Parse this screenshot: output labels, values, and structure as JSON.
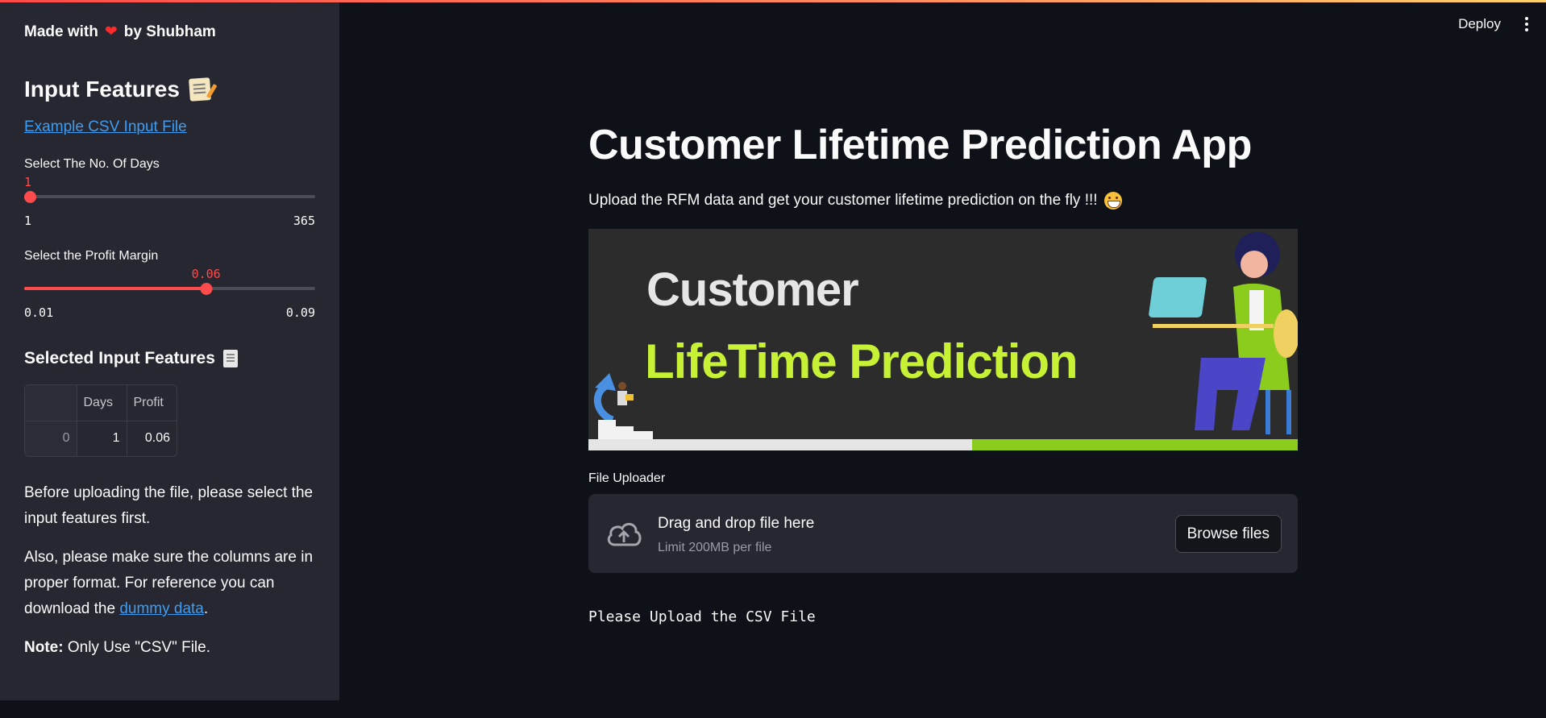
{
  "sidebar": {
    "made_with_prefix": "Made with",
    "made_with_suffix": "by Shubham",
    "heart_icon": "heart",
    "header": "Input Features",
    "example_link": "Example CSV Input File",
    "days_slider": {
      "label": "Select The No. Of Days",
      "value": "1",
      "min": "1",
      "max": "365",
      "fraction": 0.0
    },
    "profit_slider": {
      "label": "Select the Profit Margin",
      "value": "0.06",
      "min": "0.01",
      "max": "0.09",
      "fraction": 0.625
    },
    "selected_header": "Selected Input Features",
    "table": {
      "columns": [
        "",
        "Days",
        "Profit"
      ],
      "rows": [
        [
          "0",
          "1",
          "0.06"
        ]
      ]
    },
    "note1": "Before uploading the file, please select the input features first.",
    "note2_prefix": "Also, please make sure the columns are in proper format. For reference you can download the",
    "note2_link": "dummy data",
    "note2_suffix": ".",
    "note3_bold": "Note:",
    "note3_text": "Only Use \"CSV\" File."
  },
  "header": {
    "deploy": "Deploy",
    "menu_icon": "more-vertical-icon"
  },
  "main": {
    "title": "Customer Lifetime Prediction App",
    "subtitle": "Upload the RFM data and get your customer lifetime prediction on the fly !!!",
    "banner": {
      "line1": "Customer",
      "line2": "LifeTime Prediction"
    },
    "uploader": {
      "label": "File Uploader",
      "title": "Drag and drop file here",
      "limit": "Limit 200MB per file",
      "button": "Browse files"
    },
    "message": "Please Upload the CSV File"
  },
  "colors": {
    "accent": "#ff4b4b",
    "link": "#3d9df3",
    "banner_green": "#c6f134"
  }
}
